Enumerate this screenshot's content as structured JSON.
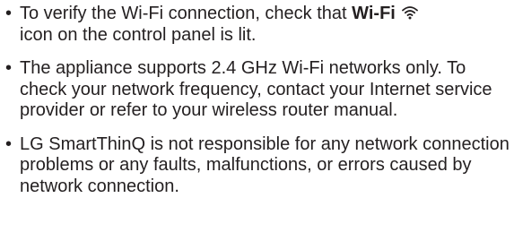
{
  "notes": [
    {
      "before": "To verify the Wi-Fi connection, check that ",
      "bold": "Wi-Fi",
      "icon": "wifi-icon",
      "after": "icon on the control panel is lit."
    },
    {
      "text": "The appliance supports 2.4 GHz Wi-Fi networks only. To check your network frequency, contact your Internet service provider or refer to your wireless router manual."
    },
    {
      "text": "LG SmartThinQ is not responsible for any network connection problems or any faults, malfunctions, or errors caused by network connection."
    }
  ],
  "bullet_char": "•"
}
